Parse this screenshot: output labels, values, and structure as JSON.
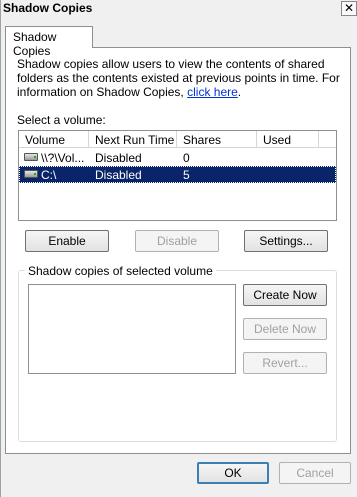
{
  "window": {
    "title": "Shadow Copies",
    "close_glyph": "✕"
  },
  "tab": {
    "label": "Shadow Copies"
  },
  "description": {
    "text": "Shadow copies allow users to view the contents of shared folders as the contents existed at previous points in time. For information on Shadow Copies, ",
    "link": "click here",
    "suffix": "."
  },
  "volumes": {
    "label": "Select a volume:",
    "columns": [
      "Volume",
      "Next Run Time",
      "Shares",
      "Used"
    ],
    "rows": [
      {
        "icon": "drive-icon",
        "volume": "\\\\?\\Vol...",
        "next_run": "Disabled",
        "shares": "0",
        "used": "",
        "selected": false
      },
      {
        "icon": "drive-icon",
        "volume": "C:\\",
        "next_run": "Disabled",
        "shares": "5",
        "used": "",
        "selected": true
      }
    ]
  },
  "buttons": {
    "enable": "Enable",
    "disable": "Disable",
    "settings": "Settings...",
    "create_now": "Create Now",
    "delete_now": "Delete Now",
    "revert": "Revert...",
    "ok": "OK",
    "cancel": "Cancel"
  },
  "copies_group": {
    "title": "Shadow copies of selected volume"
  }
}
